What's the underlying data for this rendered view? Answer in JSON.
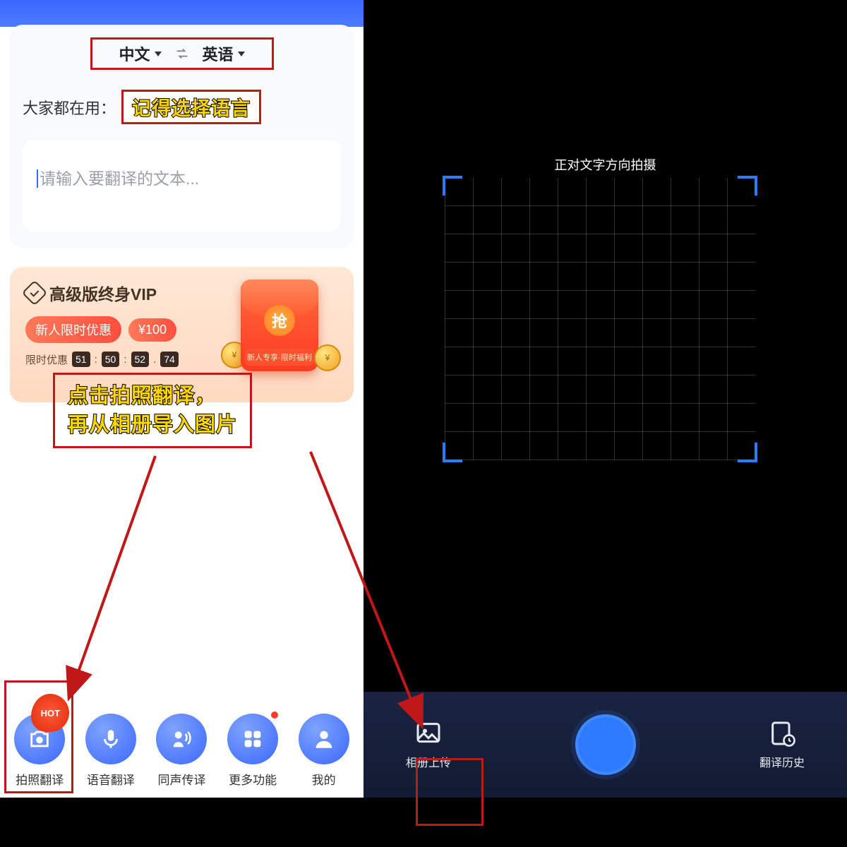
{
  "left": {
    "lang_from": "中文",
    "lang_to": "英语",
    "popular_label": "大家都在用：",
    "annotation_lang": "记得选择语言",
    "input_placeholder": "请输入要翻译的文本...",
    "vip": {
      "title": "高级版终身VIP",
      "offer_label": "新人限时优惠",
      "offer_price": "¥100",
      "countdown_label": "限时优惠",
      "envelope_badge": "抢",
      "envelope_banner": "新人专享·限时福利"
    },
    "annotation_photo_line1": "点击拍照翻译，",
    "annotation_photo_line2": "再从相册导入图片",
    "nav": [
      {
        "label": "拍照翻译",
        "hot": "HOT"
      },
      {
        "label": "语音翻译"
      },
      {
        "label": "同声传译"
      },
      {
        "label": "更多功能"
      },
      {
        "label": "我的"
      }
    ]
  },
  "right": {
    "viewfinder_hint": "正对文字方向拍摄",
    "gallery_label": "相册上传",
    "history_label": "翻译历史"
  },
  "colors": {
    "highlight_border": "#c01818",
    "primary_blue": "#3b68ff",
    "accent_blue": "#2d7bff"
  }
}
